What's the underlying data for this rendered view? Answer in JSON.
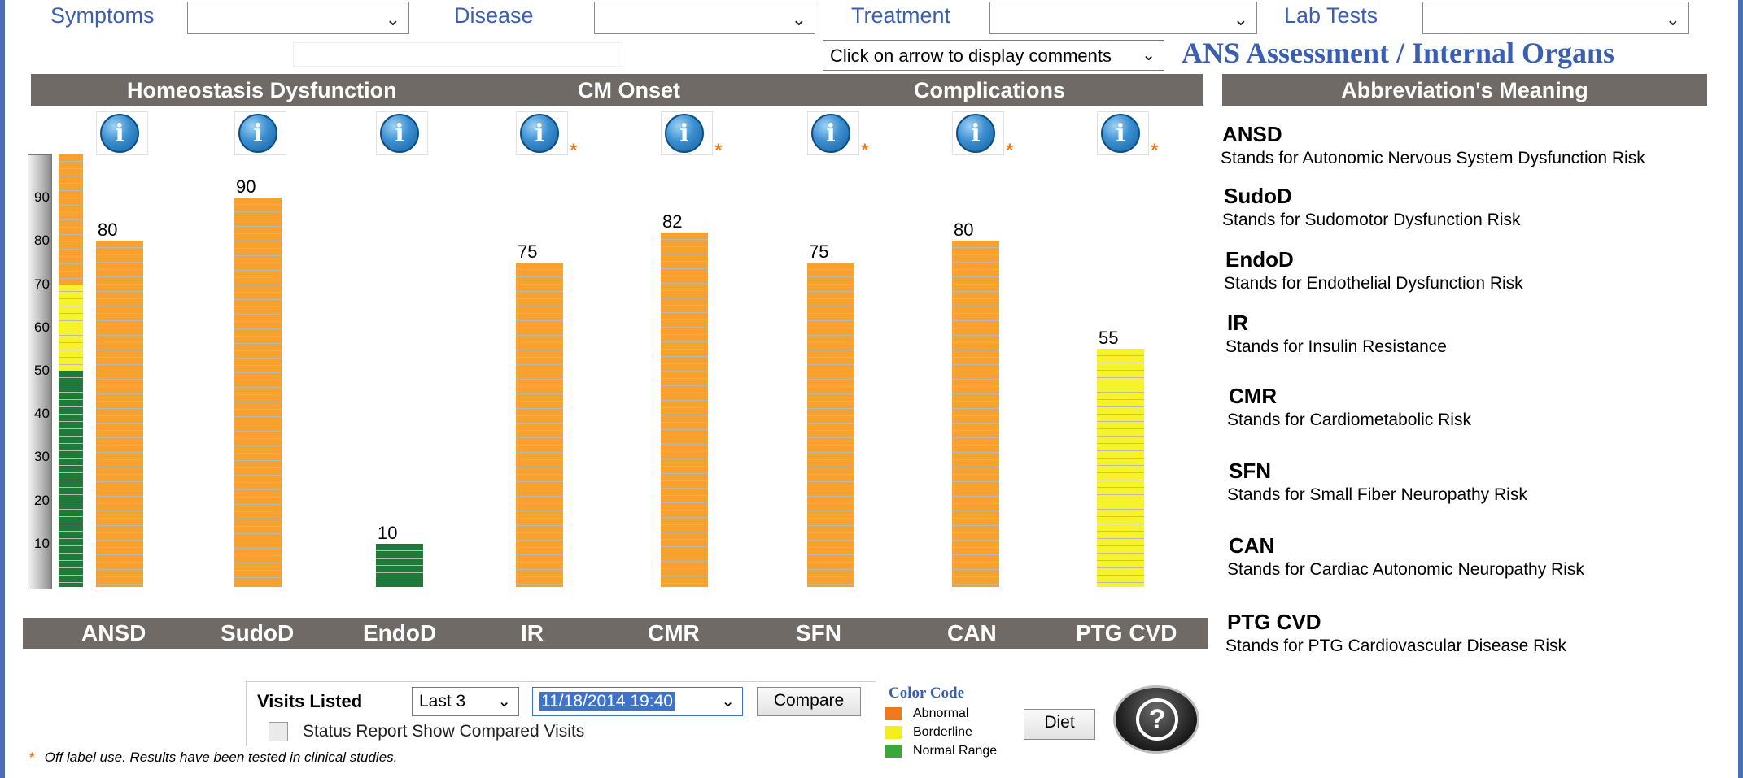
{
  "filters": {
    "symptoms": {
      "label": "Symptoms",
      "value": ""
    },
    "disease": {
      "label": "Disease",
      "value": ""
    },
    "treatment": {
      "label": "Treatment",
      "value": ""
    },
    "lab_tests": {
      "label": "Lab Tests",
      "value": ""
    }
  },
  "comments_dropdown": "Click on arrow to display comments",
  "app_title": "ANS Assessment / Internal Organs",
  "header_sections": [
    "Homeostasis Dysfunction",
    "CM Onset",
    "Complications"
  ],
  "abbr_header": "Abbreviation's Meaning",
  "scale_ticks": [
    "90",
    "80",
    "70",
    "60",
    "50",
    "40",
    "30",
    "20",
    "10"
  ],
  "chart_data": {
    "type": "bar",
    "categories": [
      "ANSD",
      "SudoD",
      "EndoD",
      "IR",
      "CMR",
      "SFN",
      "CAN",
      "PTG CVD"
    ],
    "values": [
      80,
      90,
      10,
      75,
      82,
      75,
      80,
      55
    ],
    "status": [
      "Abnormal",
      "Abnormal",
      "Normal Range",
      "Abnormal",
      "Abnormal",
      "Abnormal",
      "Abnormal",
      "Borderline"
    ],
    "off_label": [
      false,
      false,
      false,
      true,
      true,
      true,
      true,
      true
    ],
    "ylim": [
      0,
      100
    ],
    "thresholds": {
      "normal_max": 50,
      "borderline_max": 70
    }
  },
  "abbreviations": [
    {
      "code": "ANSD",
      "desc": "Stands for Autonomic Nervous System Dysfunction Risk"
    },
    {
      "code": "SudoD",
      "desc": "Stands for Sudomotor Dysfunction Risk"
    },
    {
      "code": "EndoD",
      "desc": "Stands for Endothelial Dysfunction Risk"
    },
    {
      "code": "IR",
      "desc": "Stands for Insulin Resistance"
    },
    {
      "code": "CMR",
      "desc": "Stands for Cardiometabolic Risk"
    },
    {
      "code": "SFN",
      "desc": "Stands for Small Fiber Neuropathy Risk"
    },
    {
      "code": "CAN",
      "desc": "Stands for Cardiac Autonomic Neuropathy Risk"
    },
    {
      "code": "PTG CVD",
      "desc": "Stands for PTG Cardiovascular Disease Risk"
    }
  ],
  "visits": {
    "label": "Visits Listed",
    "count_value": "Last 3",
    "date_value": "11/18/2014 19:40",
    "compare_label": "Compare",
    "status_report_label": "Status Report Show Compared Visits",
    "status_report_checked": false
  },
  "color_code": {
    "title": "Color Code",
    "items": [
      {
        "label": "Abnormal",
        "color": "#f07a1a"
      },
      {
        "label": "Borderline",
        "color": "#f5ee1f"
      },
      {
        "label": "Normal Range",
        "color": "#3aa83a"
      }
    ]
  },
  "colors": {
    "abnormal_bar": "#f7a12f",
    "borderline_bar": "#f7f32a",
    "normal_bar": "#1f7a3a",
    "accent": "#3a5fb0"
  },
  "diet_label": "Diet",
  "help_icon": "question-icon",
  "info_icon": "info-icon",
  "off_label_note": "Off label use. Results have been tested in clinical studies."
}
